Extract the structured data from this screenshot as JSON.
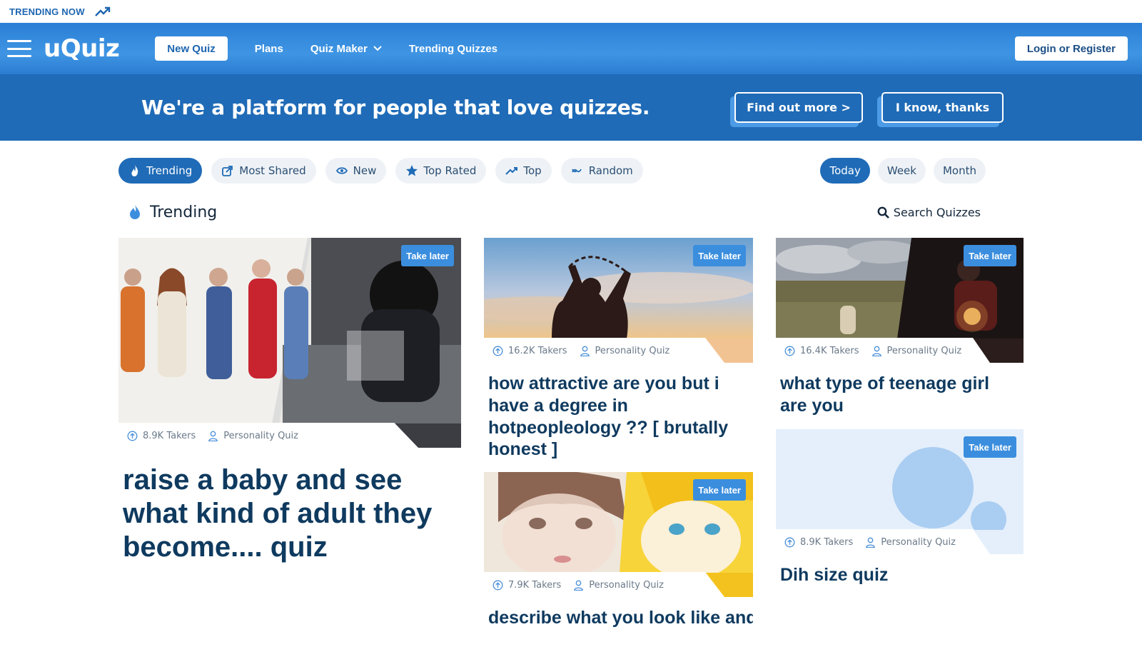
{
  "top_strip": {
    "label": "TRENDING NOW"
  },
  "nav": {
    "logo": "uQuiz",
    "new_quiz": "New Quiz",
    "plans": "Plans",
    "quiz_maker": "Quiz Maker",
    "trending_quizzes": "Trending Quizzes",
    "login": "Login or Register"
  },
  "banner": {
    "text": "We're a platform for people that love quizzes.",
    "find_out": "Find out more >",
    "dismiss": "I know, thanks"
  },
  "filters": {
    "tabs": [
      "Trending",
      "Most Shared",
      "New",
      "Top Rated",
      "Top",
      "Random"
    ],
    "time": [
      "Today",
      "Week",
      "Month"
    ]
  },
  "section": {
    "title": "Trending",
    "search": "Search Quizzes"
  },
  "cards": [
    {
      "take_later": "Take later",
      "takers": "8.9K Takers",
      "kind": "Personality Quiz",
      "title": "raise a baby and see what kind of adult they become.... quiz"
    },
    {
      "take_later": "Take later",
      "takers": "16.2K Takers",
      "kind": "Personality Quiz",
      "title": "how attractive are you but i have a degree in hotpeopleology ?? [ brutally honest ]"
    },
    {
      "take_later": "Take later",
      "takers": "16.4K Takers",
      "kind": "Personality Quiz",
      "title": "what type of teenage girl are you"
    },
    {
      "take_later": "Take later",
      "takers": "7.9K Takers",
      "kind": "Personality Quiz",
      "title": "describe what you look like and get a drawing"
    },
    {
      "take_later": "Take later",
      "takers": "8.9K Takers",
      "kind": "Personality Quiz",
      "title": "Dih size quiz"
    }
  ],
  "colors": {
    "brand": "#1f6bb7",
    "nav_light": "#3f95e3",
    "title": "#0f3a5f"
  }
}
